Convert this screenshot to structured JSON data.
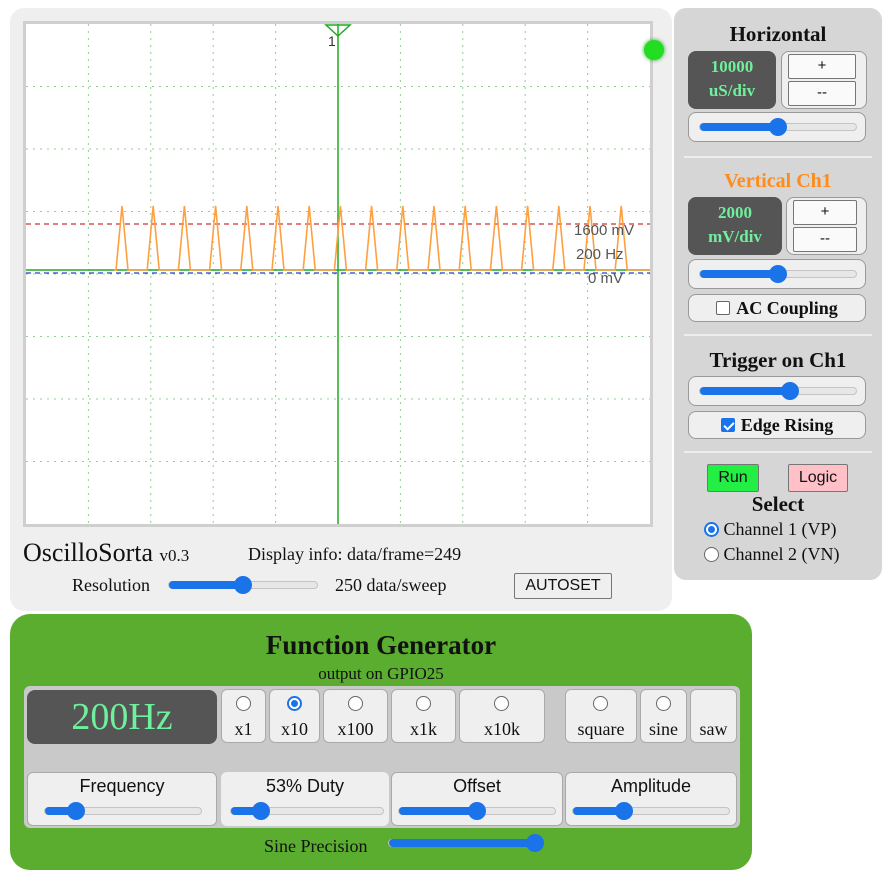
{
  "scope": {
    "trigger_marker_label": "1",
    "overlay": {
      "voltage_level": "1600 mV",
      "frequency": "200 Hz",
      "zero_level": "0 mV"
    },
    "title": "OscilloSorta",
    "version": "v0.3",
    "display_info": "Display info: data/frame=249",
    "resolution_label": "Resolution",
    "resolution_value": "250 data/sweep",
    "resolution_slider": 0.5,
    "autoset_label": "AUTOSET",
    "colors": {
      "trace": "#ffa040",
      "trigger_level": "#cc3333",
      "zero_level": "#2244cc",
      "axis": "#22aa22",
      "status": "#22dd22"
    }
  },
  "horizontal": {
    "title": "Horizontal",
    "value_line1": "10000",
    "value_line2": "uS/div",
    "plus_label": "+",
    "minus_label": "--",
    "slider": 0.5
  },
  "vertical": {
    "title": "Vertical Ch1",
    "title_color": "#ff8c1a",
    "value_line1": "2000",
    "value_line2": "mV/div",
    "plus_label": "+",
    "minus_label": "--",
    "slider": 0.5,
    "ac_coupling_label": "AC Coupling",
    "ac_coupling_checked": false
  },
  "trigger": {
    "title": "Trigger on Ch1",
    "slider": 0.58,
    "edge_label": "Edge Rising",
    "edge_checked": true
  },
  "mode": {
    "run_label": "Run",
    "logic_label": "Logic",
    "select_title": "Select",
    "channels": [
      {
        "label": "Channel 1 (VP)",
        "selected": true
      },
      {
        "label": "Channel 2 (VN)",
        "selected": false
      }
    ]
  },
  "function_generator": {
    "title": "Function Generator",
    "subtitle": "output on GPIO25",
    "frequency_display": "200Hz",
    "multipliers": [
      {
        "label": "x1",
        "selected": false
      },
      {
        "label": "x10",
        "selected": true
      },
      {
        "label": "x100",
        "selected": false
      },
      {
        "label": "x1k",
        "selected": false
      },
      {
        "label": "x10k",
        "selected": false
      }
    ],
    "waveforms": [
      {
        "label": "square",
        "selected": false
      },
      {
        "label": "sine",
        "selected": false
      },
      {
        "label": "saw",
        "selected": false
      }
    ],
    "controls": [
      {
        "label": "Frequency",
        "value": 0.2
      },
      {
        "label": "53% Duty",
        "value": 0.2
      },
      {
        "label": "Offset",
        "value": 0.5
      },
      {
        "label": "Amplitude",
        "value": 0.33
      }
    ],
    "sine_precision_label": "Sine Precision",
    "sine_precision_value": 1.0
  }
}
